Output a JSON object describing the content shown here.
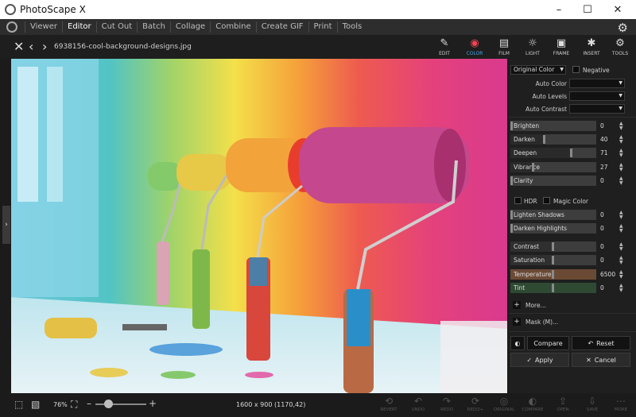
{
  "window": {
    "title": "PhotoScape X",
    "minimize_icon": "–",
    "maximize_icon": "☐",
    "close_icon": "✕"
  },
  "menu": {
    "items": [
      "Viewer",
      "Editor",
      "Cut Out",
      "Batch",
      "Collage",
      "Combine",
      "Create GIF",
      "Print",
      "Tools"
    ],
    "active": "Editor"
  },
  "toolbar": {
    "filename": "6938156-cool-background-designs.jpg",
    "tools": [
      {
        "label": "EDIT",
        "icon": "✎"
      },
      {
        "label": "COLOR",
        "icon": "◉"
      },
      {
        "label": "FILM",
        "icon": "▤"
      },
      {
        "label": "LIGHT",
        "icon": "☼"
      },
      {
        "label": "FRAME",
        "icon": "▣"
      },
      {
        "label": "INSERT",
        "icon": "✱"
      },
      {
        "label": "TOOLS",
        "icon": "⚙"
      }
    ],
    "active_tool": "COLOR"
  },
  "panel": {
    "color_mode": "Original Color",
    "negative_label": "Negative",
    "auto": [
      {
        "label": "Auto Color",
        "value": ""
      },
      {
        "label": "Auto Levels",
        "value": ""
      },
      {
        "label": "Auto Contrast",
        "value": ""
      }
    ],
    "sliders1": [
      {
        "label": "Brighten",
        "value": "0",
        "level": 0.0
      },
      {
        "label": "Darken",
        "value": "40",
        "level": 0.4
      },
      {
        "label": "Deepen",
        "value": "71",
        "level": 0.71
      },
      {
        "label": "Vibrance",
        "value": "27",
        "level": 0.27
      },
      {
        "label": "Clarity",
        "value": "0",
        "level": 0.0
      }
    ],
    "hdr_label": "HDR",
    "magic_label": "Magic Color",
    "sliders2": [
      {
        "label": "Lighten Shadows",
        "value": "0",
        "level": 0.0
      },
      {
        "label": "Darken Highlights",
        "value": "0",
        "level": 0.0
      }
    ],
    "sliders3": [
      {
        "label": "Contrast",
        "value": "0",
        "level": 0.5
      },
      {
        "label": "Saturation",
        "value": "0",
        "level": 0.5
      },
      {
        "label": "Temperature",
        "value": "6500",
        "level": 0.5
      },
      {
        "label": "Tint",
        "value": "0",
        "level": 0.5
      }
    ],
    "more_label": "More...",
    "mask_label": "Mask (M)...",
    "compare_label": "Compare",
    "reset_label": "Reset",
    "apply_label": "Apply",
    "cancel_label": "Cancel"
  },
  "status": {
    "zoom": "76%",
    "dimensions": "1600 x 900 (1170,42)",
    "history": [
      {
        "label": "REVERT",
        "icon": "⟲"
      },
      {
        "label": "UNDO",
        "icon": "↶"
      },
      {
        "label": "REDO",
        "icon": "↷"
      },
      {
        "label": "REDO+",
        "icon": "⟳"
      },
      {
        "label": "ORIGINAL",
        "icon": "◎"
      },
      {
        "label": "COMPARE",
        "icon": "◐"
      },
      {
        "label": "OPEN",
        "icon": "⇪"
      },
      {
        "label": "SAVE",
        "icon": "⇩"
      },
      {
        "label": "MORE",
        "icon": "⋯"
      }
    ]
  },
  "colors": {
    "accent": "#4aa3df",
    "panel_bg": "#1f1f1f",
    "temperature_fill": "#6b4a35",
    "tint_fill": "#2f4a33"
  }
}
